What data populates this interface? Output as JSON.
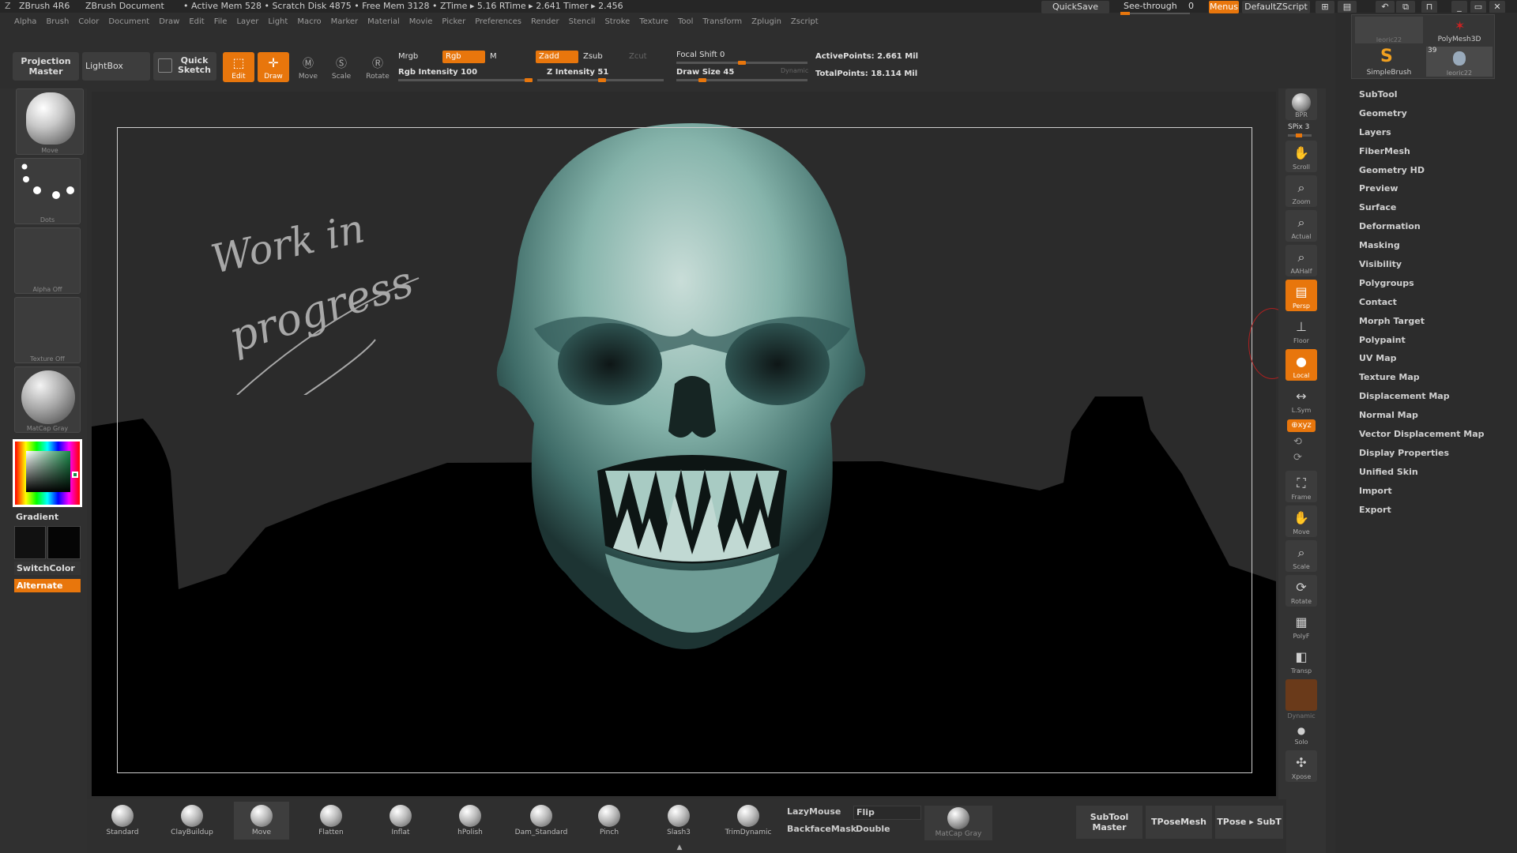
{
  "title_bar": {
    "app_name": "ZBrush 4R6",
    "document": "ZBrush Document",
    "stats": "• Active Mem 528  • Scratch Disk 4875  • Free Mem 3128  • ZTime ▸ 5.16  RTime ▸ 2.641  Timer ▸ 2.456",
    "quicksave": "QuickSave",
    "see_through": "See-through",
    "see_through_value": "0",
    "menus": "Menus",
    "default_zscript": "DefaultZScript"
  },
  "menu_items": [
    "Alpha",
    "Brush",
    "Color",
    "Document",
    "Draw",
    "Edit",
    "File",
    "Layer",
    "Light",
    "Macro",
    "Marker",
    "Material",
    "Movie",
    "Picker",
    "Preferences",
    "Render",
    "Stencil",
    "Stroke",
    "Texture",
    "Tool",
    "Transform",
    "Zplugin",
    "Zscript"
  ],
  "toolbar": {
    "projection_master": "Projection Master",
    "lightbox": "LightBox",
    "quick_sketch": "Quick Sketch",
    "edit": "Edit",
    "draw": "Draw",
    "move": "Move",
    "scale": "Scale",
    "rotate": "Rotate",
    "mrgb": "Mrgb",
    "rgb": "Rgb",
    "m": "M",
    "rgb_intensity": "Rgb Intensity 100",
    "rgb_intensity_value": 100,
    "zadd": "Zadd",
    "zsub": "Zsub",
    "zcut": "Zcut",
    "z_intensity": "Z Intensity 51",
    "z_intensity_value": 51,
    "focal_shift": "Focal Shift 0",
    "focal_shift_value": 0,
    "draw_size": "Draw Size 45",
    "draw_size_value": 45,
    "dynamic": "Dynamic",
    "active_points": "ActivePoints: 2.661 Mil",
    "total_points": "TotalPoints: 18.114 Mil"
  },
  "left_shelf": {
    "move_label": "Move",
    "dots_label": "Dots",
    "alpha_label": "Alpha  Off",
    "texture_label": "Texture  Off",
    "matcap_label": "MatCap  Gray",
    "gradient": "Gradient",
    "switch_color": "SwitchColor",
    "alternate": "Alternate"
  },
  "canvas": {
    "note_line1": "Work in",
    "note_line2": "progress"
  },
  "right_dock": {
    "bpr": "BPR",
    "spix": "SPix 3",
    "scroll": "Scroll",
    "zoom": "Zoom",
    "actual": "Actual",
    "aahalf": "AAHalf",
    "persp": "Persp",
    "floor": "Floor",
    "local": "Local",
    "lsym": "L.Sym",
    "xyz": "⊕xyz",
    "frame": "Frame",
    "move": "Move",
    "scale": "Scale",
    "rotate": "Rotate",
    "polyf": "PolyF",
    "transp": "Transp",
    "dynamic": "Dynamic",
    "solo": "Solo",
    "xpose": "Xpose"
  },
  "tool_thumbs": {
    "t1": "leoric22",
    "t2": "PolyMesh3D",
    "t3": "SimpleBrush",
    "t4": "leoric22",
    "badge": "39"
  },
  "tool_menu": [
    "SubTool",
    "Geometry",
    "Layers",
    "FiberMesh",
    "Geometry HD",
    "Preview",
    "Surface",
    "Deformation",
    "Masking",
    "Visibility",
    "Polygroups",
    "Contact",
    "Morph Target",
    "Polypaint",
    "UV Map",
    "Texture Map",
    "Displacement Map",
    "Normal Map",
    "Vector Displacement Map",
    "Display Properties",
    "Unified Skin",
    "Import",
    "Export"
  ],
  "bottom_shelf": {
    "brushes": [
      "Standard",
      "ClayBuildup",
      "Move",
      "Flatten",
      "Inflat",
      "hPolish",
      "Dam_Standard",
      "Pinch",
      "Slash3",
      "TrimDynamic"
    ],
    "lazy_mouse": "LazyMouse",
    "backface_mask": "BackfaceMask",
    "flip": "Flip",
    "double": "Double",
    "matcap": "MatCap  Gray",
    "subtool_master": "SubTool Master",
    "tposemesh": "TPoseMesh",
    "tpose_subt": "TPose ▸ SubT"
  },
  "colors": {
    "accent": "#e8760c",
    "panel": "#3c3c3c",
    "canvas": "#2b2b2b",
    "skull": "#7fb3aa"
  }
}
